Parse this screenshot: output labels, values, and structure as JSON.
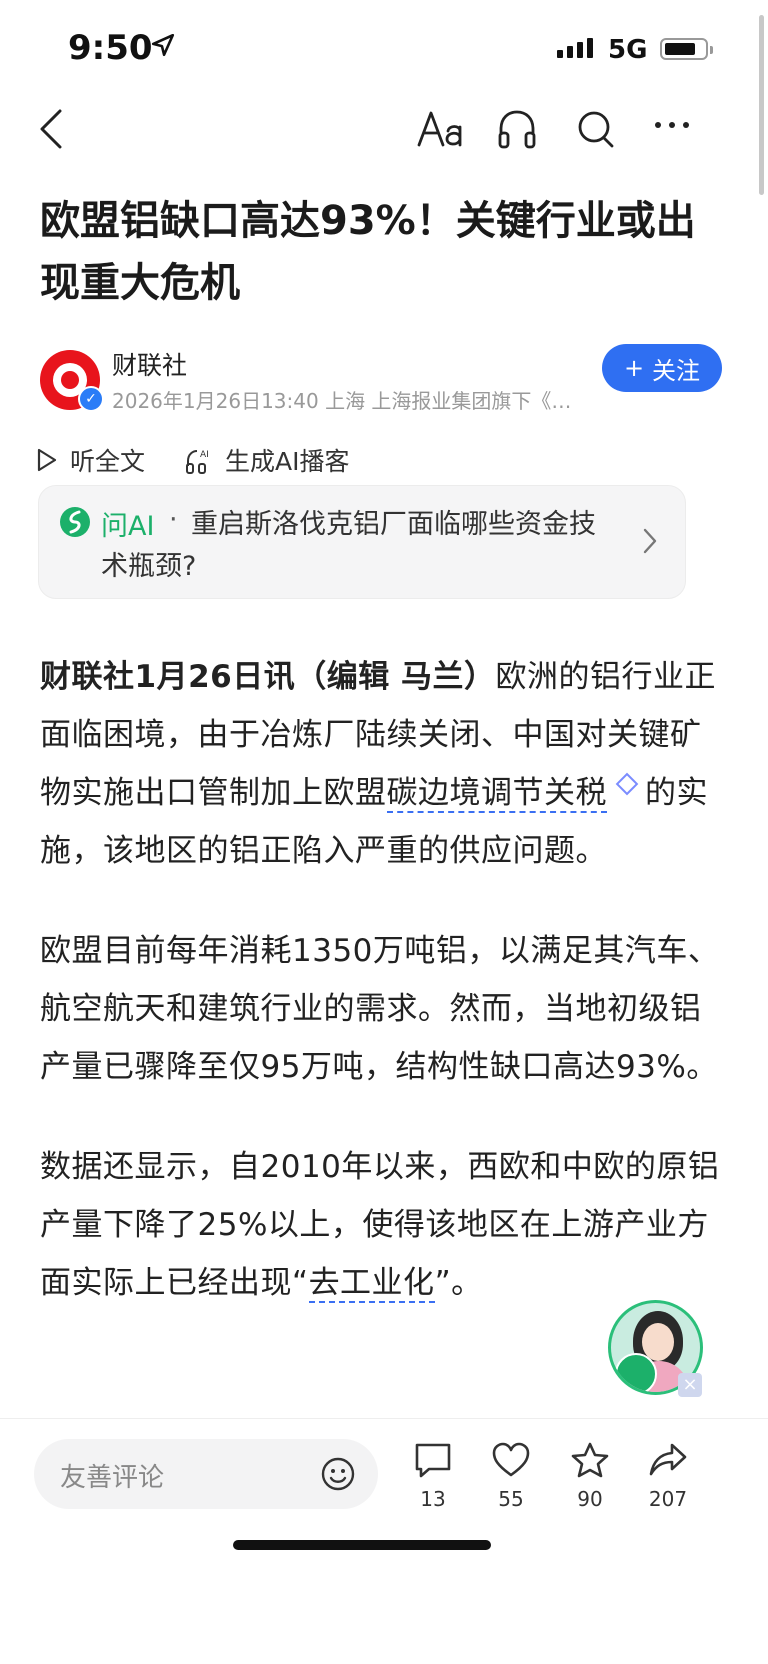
{
  "status": {
    "time": "9:50",
    "network": "5G"
  },
  "article": {
    "title": "欧盟铝缺口高达93%！关键行业或出现重大危机",
    "source": "财联社",
    "meta": "2026年1月26日13:40 上海 上海报业集团旗下《…",
    "follow_label": "关注",
    "listen_label": "听全文",
    "podcast_label": "生成AI播客",
    "ai_label": "问AI",
    "ai_dot": "·",
    "ai_question": "重启斯洛伐克铝厂面临哪些资金技术瓶颈?",
    "p1_lead": "财联社1月26日讯（编辑 马兰）",
    "p1_a": "欧洲的铝行业正面临困境，由于冶炼厂陆续关闭、中国对关键矿物实施出口管制加上欧盟",
    "p1_kw": "碳边境调节关税",
    "p1_b": "的实施，该地区的铝正陷入严重的供应问题。",
    "p2": "欧盟目前每年消耗1350万吨铝，以满足其汽车、航空航天和建筑行业的需求。然而，当地初级铝产量已骤降至仅95万吨，结构性缺口高达93%。",
    "p3_a": "数据还显示，自2010年以来，西欧和中欧的原铝产量下降了25%以上，使得该地区在上游产业方面实际上已经出现“",
    "p3_kw": "去工业化",
    "p3_b": "”。"
  },
  "bottom": {
    "comment_placeholder": "友善评论",
    "comments": "13",
    "likes": "55",
    "favorites": "90",
    "shares": "207"
  },
  "icons": {
    "back": "chevron-left-icon",
    "font": "font-size-icon",
    "audio": "headphones-icon",
    "search": "search-icon",
    "more": "more-icon"
  },
  "colors": {
    "accent": "#2f6ff2",
    "ai_green": "#1cb06a",
    "brand_red": "#e8141c"
  }
}
